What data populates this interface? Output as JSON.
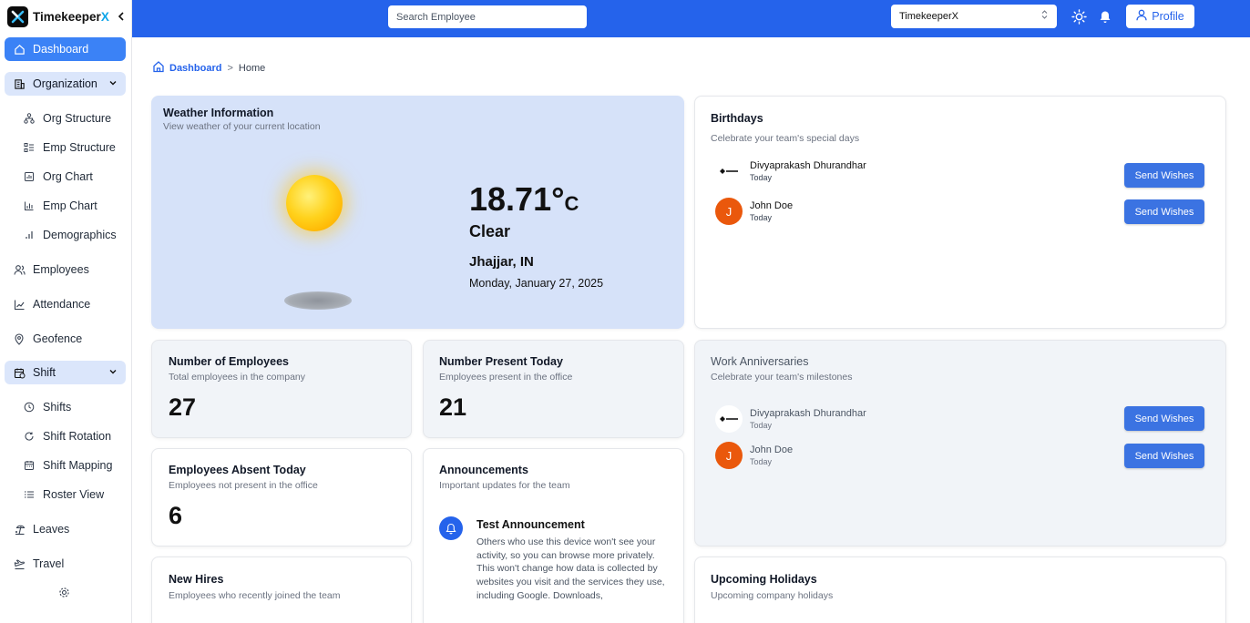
{
  "app": {
    "name_main": "Timekeeper",
    "name_accent": "X"
  },
  "sidebar": {
    "items": [
      {
        "label": "Dashboard",
        "icon": "home-icon"
      },
      {
        "label": "Organization",
        "icon": "building-icon"
      },
      {
        "label": "Org Structure",
        "icon": "hierarchy-icon"
      },
      {
        "label": "Emp Structure",
        "icon": "list-tree-icon"
      },
      {
        "label": "Org Chart",
        "icon": "chart-icon"
      },
      {
        "label": "Emp Chart",
        "icon": "bar-chart-icon"
      },
      {
        "label": "Demographics",
        "icon": "signal-icon"
      },
      {
        "label": "Employees",
        "icon": "users-icon"
      },
      {
        "label": "Attendance",
        "icon": "line-chart-icon"
      },
      {
        "label": "Geofence",
        "icon": "map-pin-icon"
      },
      {
        "label": "Shift",
        "icon": "calendar-clock-icon"
      },
      {
        "label": "Shifts",
        "icon": "clock-icon"
      },
      {
        "label": "Shift Rotation",
        "icon": "rotate-icon"
      },
      {
        "label": "Shift Mapping",
        "icon": "calendar-icon"
      },
      {
        "label": "Roster View",
        "icon": "list-icon"
      },
      {
        "label": "Leaves",
        "icon": "beach-icon"
      },
      {
        "label": "Travel",
        "icon": "plane-icon"
      }
    ]
  },
  "topbar": {
    "search_placeholder": "Search Employee",
    "org_selected": "TimekeeperX",
    "profile_label": "Profile"
  },
  "breadcrumb": {
    "home": "Dashboard",
    "separator": ">",
    "current": "Home"
  },
  "weather": {
    "title": "Weather Information",
    "subtitle": "View weather of your current location",
    "temp": "18.71°",
    "unit": "C",
    "condition": "Clear",
    "location": "Jhajjar, IN",
    "date": "Monday, January 27, 2025"
  },
  "birthdays": {
    "title": "Birthdays",
    "subtitle": "Celebrate your team's special days",
    "people": [
      {
        "name": "Divyaprakash Dhurandhar",
        "when": "Today",
        "initial": ""
      },
      {
        "name": "John Doe",
        "when": "Today",
        "initial": "J"
      }
    ],
    "button": "Send Wishes"
  },
  "stats": {
    "employees": {
      "title": "Number of Employees",
      "subtitle": "Total employees in the company",
      "value": "27"
    },
    "present": {
      "title": "Number Present Today",
      "subtitle": "Employees present in the office",
      "value": "21"
    },
    "absent": {
      "title": "Employees Absent Today",
      "subtitle": "Employees not present in the office",
      "value": "6"
    }
  },
  "anniversaries": {
    "title": "Work Anniversaries",
    "subtitle": "Celebrate your team's milestones",
    "people": [
      {
        "name": "Divyaprakash Dhurandhar",
        "when": "Today",
        "initial": ""
      },
      {
        "name": "John Doe",
        "when": "Today",
        "initial": "J"
      }
    ],
    "button": "Send Wishes"
  },
  "announcements": {
    "title": "Announcements",
    "subtitle": "Important updates for the team",
    "item_title": "Test Announcement",
    "item_body": "Others who use this device won't see your activity, so you can browse more privately. This won't change how data is collected by websites you visit and the services they use, including Google. Downloads,"
  },
  "new_hires": {
    "title": "New Hires",
    "subtitle": "Employees who recently joined the team"
  },
  "holidays": {
    "title": "Upcoming Holidays",
    "subtitle": "Upcoming company holidays"
  },
  "colors": {
    "primary": "#2563eb",
    "weather_bg": "#d6e2f9",
    "avatar_j": "#ea580c"
  }
}
